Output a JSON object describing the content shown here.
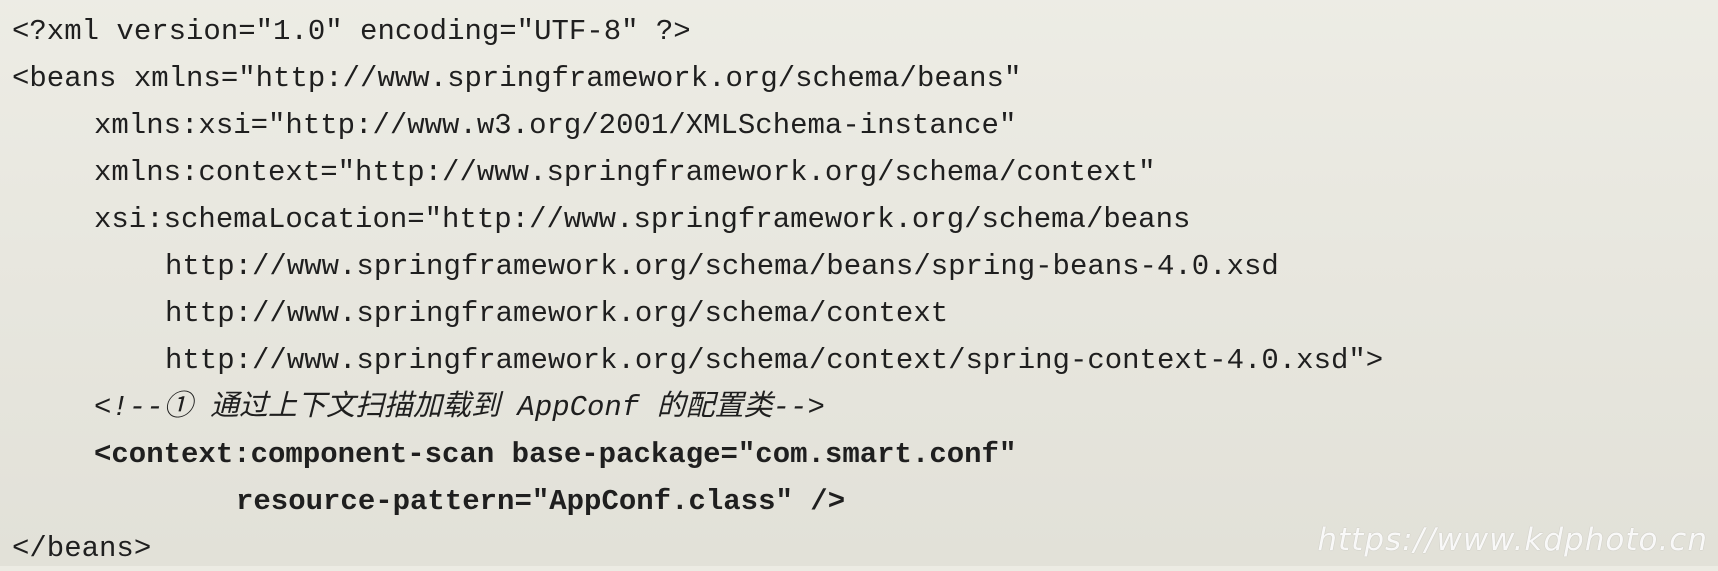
{
  "document": {
    "code_lines": [
      "<?xml version=\"1.0\" encoding=\"UTF-8\" ?>",
      "<beans xmlns=\"http://www.springframework.org/schema/beans\"",
      "xmlns:xsi=\"http://www.w3.org/2001/XMLSchema-instance\"",
      "xmlns:context=\"http://www.springframework.org/schema/context\"",
      "xsi:schemaLocation=\"http://www.springframework.org/schema/beans",
      "http://www.springframework.org/schema/beans/spring-beans-4.0.xsd",
      "http://www.springframework.org/schema/context",
      "http://www.springframework.org/schema/context/spring-context-4.0.xsd\">",
      "<!--① 通过上下文扫描加载到 AppConf 的配置类-->",
      "<context:component-scan base-package=\"com.smart.conf\"",
      "resource-pattern=\"AppConf.class\" />",
      "</beans>"
    ],
    "watermark": "https://www.kdphoto.cn"
  }
}
